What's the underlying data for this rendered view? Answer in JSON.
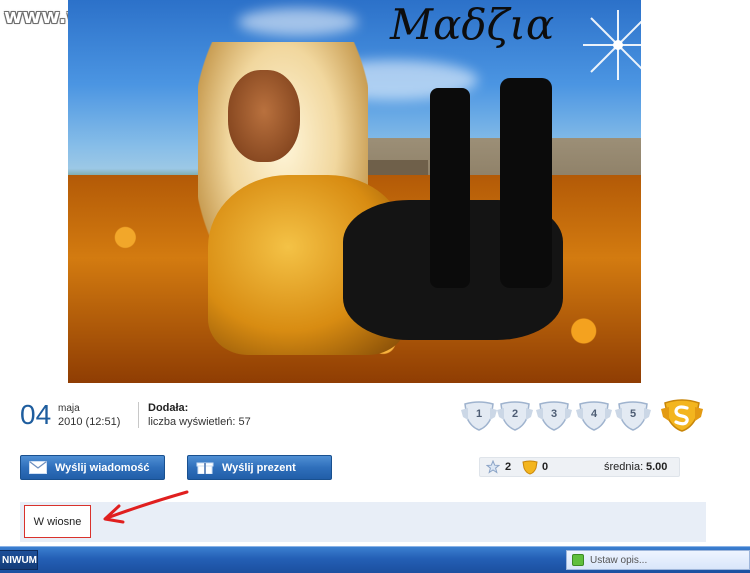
{
  "watermark": "www.wiocha.pl",
  "photo": {
    "title": "Μαδζια"
  },
  "post": {
    "day": "04",
    "month": "maja",
    "year_time": "2010 (12:51)",
    "added_label": "Dodała:",
    "views": "liczba wyświetleń: 57"
  },
  "rating": {
    "options": [
      "1",
      "2",
      "3",
      "4",
      "5"
    ]
  },
  "actions": {
    "send_message": "Wyślij wiadomość",
    "send_gift": "Wyślij prezent"
  },
  "stats": {
    "star_count": "2",
    "super_count": "0",
    "average_label": "średnia:",
    "average_value": "5.00"
  },
  "description": {
    "text": "W wiosne"
  },
  "taskbar": {
    "left_button": "NIWUM",
    "status_text": "Ustaw opis..."
  }
}
